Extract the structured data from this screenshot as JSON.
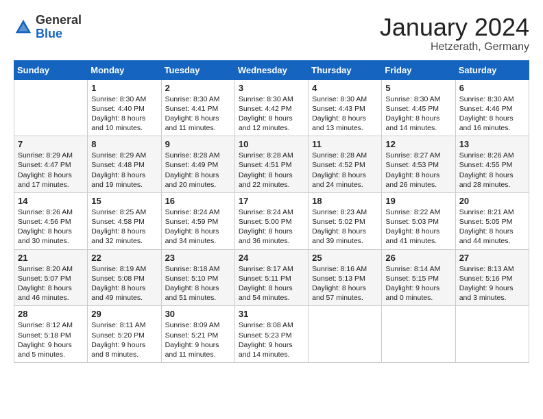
{
  "header": {
    "logo_general": "General",
    "logo_blue": "Blue",
    "month": "January 2024",
    "location": "Hetzerath, Germany"
  },
  "days_of_week": [
    "Sunday",
    "Monday",
    "Tuesday",
    "Wednesday",
    "Thursday",
    "Friday",
    "Saturday"
  ],
  "weeks": [
    [
      {
        "day": "",
        "content": ""
      },
      {
        "day": "1",
        "content": "Sunrise: 8:30 AM\nSunset: 4:40 PM\nDaylight: 8 hours\nand 10 minutes."
      },
      {
        "day": "2",
        "content": "Sunrise: 8:30 AM\nSunset: 4:41 PM\nDaylight: 8 hours\nand 11 minutes."
      },
      {
        "day": "3",
        "content": "Sunrise: 8:30 AM\nSunset: 4:42 PM\nDaylight: 8 hours\nand 12 minutes."
      },
      {
        "day": "4",
        "content": "Sunrise: 8:30 AM\nSunset: 4:43 PM\nDaylight: 8 hours\nand 13 minutes."
      },
      {
        "day": "5",
        "content": "Sunrise: 8:30 AM\nSunset: 4:45 PM\nDaylight: 8 hours\nand 14 minutes."
      },
      {
        "day": "6",
        "content": "Sunrise: 8:30 AM\nSunset: 4:46 PM\nDaylight: 8 hours\nand 16 minutes."
      }
    ],
    [
      {
        "day": "7",
        "content": "Sunrise: 8:29 AM\nSunset: 4:47 PM\nDaylight: 8 hours\nand 17 minutes."
      },
      {
        "day": "8",
        "content": "Sunrise: 8:29 AM\nSunset: 4:48 PM\nDaylight: 8 hours\nand 19 minutes."
      },
      {
        "day": "9",
        "content": "Sunrise: 8:28 AM\nSunset: 4:49 PM\nDaylight: 8 hours\nand 20 minutes."
      },
      {
        "day": "10",
        "content": "Sunrise: 8:28 AM\nSunset: 4:51 PM\nDaylight: 8 hours\nand 22 minutes."
      },
      {
        "day": "11",
        "content": "Sunrise: 8:28 AM\nSunset: 4:52 PM\nDaylight: 8 hours\nand 24 minutes."
      },
      {
        "day": "12",
        "content": "Sunrise: 8:27 AM\nSunset: 4:53 PM\nDaylight: 8 hours\nand 26 minutes."
      },
      {
        "day": "13",
        "content": "Sunrise: 8:26 AM\nSunset: 4:55 PM\nDaylight: 8 hours\nand 28 minutes."
      }
    ],
    [
      {
        "day": "14",
        "content": "Sunrise: 8:26 AM\nSunset: 4:56 PM\nDaylight: 8 hours\nand 30 minutes."
      },
      {
        "day": "15",
        "content": "Sunrise: 8:25 AM\nSunset: 4:58 PM\nDaylight: 8 hours\nand 32 minutes."
      },
      {
        "day": "16",
        "content": "Sunrise: 8:24 AM\nSunset: 4:59 PM\nDaylight: 8 hours\nand 34 minutes."
      },
      {
        "day": "17",
        "content": "Sunrise: 8:24 AM\nSunset: 5:00 PM\nDaylight: 8 hours\nand 36 minutes."
      },
      {
        "day": "18",
        "content": "Sunrise: 8:23 AM\nSunset: 5:02 PM\nDaylight: 8 hours\nand 39 minutes."
      },
      {
        "day": "19",
        "content": "Sunrise: 8:22 AM\nSunset: 5:03 PM\nDaylight: 8 hours\nand 41 minutes."
      },
      {
        "day": "20",
        "content": "Sunrise: 8:21 AM\nSunset: 5:05 PM\nDaylight: 8 hours\nand 44 minutes."
      }
    ],
    [
      {
        "day": "21",
        "content": "Sunrise: 8:20 AM\nSunset: 5:07 PM\nDaylight: 8 hours\nand 46 minutes."
      },
      {
        "day": "22",
        "content": "Sunrise: 8:19 AM\nSunset: 5:08 PM\nDaylight: 8 hours\nand 49 minutes."
      },
      {
        "day": "23",
        "content": "Sunrise: 8:18 AM\nSunset: 5:10 PM\nDaylight: 8 hours\nand 51 minutes."
      },
      {
        "day": "24",
        "content": "Sunrise: 8:17 AM\nSunset: 5:11 PM\nDaylight: 8 hours\nand 54 minutes."
      },
      {
        "day": "25",
        "content": "Sunrise: 8:16 AM\nSunset: 5:13 PM\nDaylight: 8 hours\nand 57 minutes."
      },
      {
        "day": "26",
        "content": "Sunrise: 8:14 AM\nSunset: 5:15 PM\nDaylight: 9 hours\nand 0 minutes."
      },
      {
        "day": "27",
        "content": "Sunrise: 8:13 AM\nSunset: 5:16 PM\nDaylight: 9 hours\nand 3 minutes."
      }
    ],
    [
      {
        "day": "28",
        "content": "Sunrise: 8:12 AM\nSunset: 5:18 PM\nDaylight: 9 hours\nand 5 minutes."
      },
      {
        "day": "29",
        "content": "Sunrise: 8:11 AM\nSunset: 5:20 PM\nDaylight: 9 hours\nand 8 minutes."
      },
      {
        "day": "30",
        "content": "Sunrise: 8:09 AM\nSunset: 5:21 PM\nDaylight: 9 hours\nand 11 minutes."
      },
      {
        "day": "31",
        "content": "Sunrise: 8:08 AM\nSunset: 5:23 PM\nDaylight: 9 hours\nand 14 minutes."
      },
      {
        "day": "",
        "content": ""
      },
      {
        "day": "",
        "content": ""
      },
      {
        "day": "",
        "content": ""
      }
    ]
  ]
}
